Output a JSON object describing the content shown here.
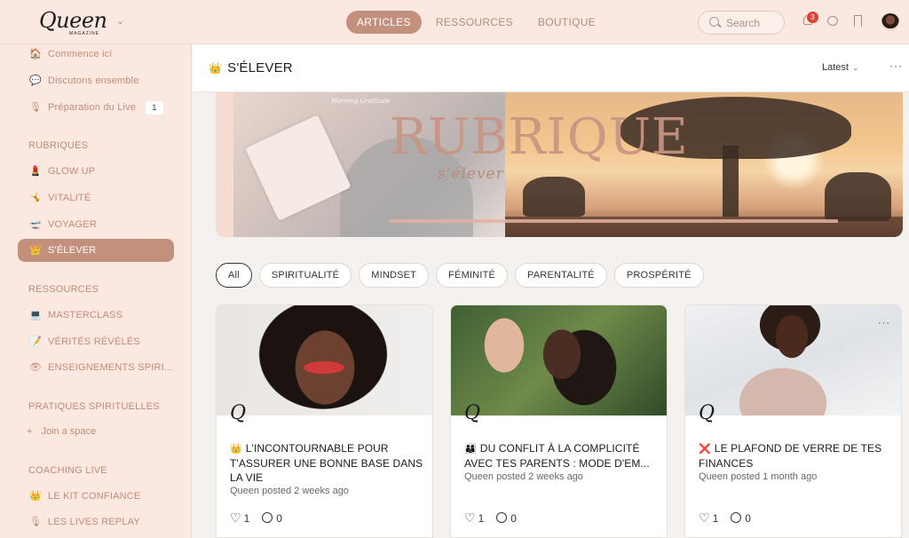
{
  "brand": {
    "logo_text": "Queen",
    "logo_sub": "MAGAZINE"
  },
  "nav": {
    "tabs": [
      "ARTICLES",
      "RESSOURCES",
      "BOUTIQUE"
    ],
    "active": "ARTICLES"
  },
  "search": {
    "placeholder": "Search"
  },
  "notifications": {
    "count": "3"
  },
  "sidebar": {
    "top_items": [
      {
        "emoji": "🏠",
        "label": "Commence ici"
      },
      {
        "emoji": "💬",
        "label": "Discutons ensemble"
      },
      {
        "emoji": "🎙",
        "label": "Préparation du Live",
        "count": "1"
      }
    ],
    "rubriques_heading": "RUBRIQUES",
    "rubriques": [
      {
        "emoji": "💄",
        "label": "GLOW UP"
      },
      {
        "emoji": "🤸",
        "label": "VITALITÉ"
      },
      {
        "emoji": "🛫",
        "label": "VOYAGER"
      },
      {
        "emoji": "👑",
        "label": "S'ÉLEVER"
      }
    ],
    "ressources_heading": "RESSOURCES",
    "ressources": [
      {
        "emoji": "💻",
        "label": "MASTERCLASS"
      },
      {
        "emoji": "📝",
        "label": "VÉRITÉS RÉVÉLÉS"
      },
      {
        "emoji": "👁",
        "label": "ENSEIGNEMENTS SPIRI..."
      }
    ],
    "pratiques_heading": "PRATIQUES SPIRITUELLES",
    "join_label": "Join a space",
    "coaching_heading": "COACHING LIVE",
    "coaching": [
      {
        "emoji": "👑",
        "label": "LE KIT CONFIANCE"
      },
      {
        "emoji": "🎙",
        "label": "LES LIVES REPLAY"
      }
    ]
  },
  "page": {
    "title_emoji": "👑",
    "title": "S'ÉLEVER",
    "sort_label": "Latest",
    "more": "···"
  },
  "banner": {
    "word": "RUBRIQUE",
    "script": "s'élever",
    "caption": "Morning Gratitude"
  },
  "filters": [
    "All",
    "SPIRITUALITÉ",
    "MINDSET",
    "FÉMINITÉ",
    "PARENTALITÉ",
    "PROSPÉRITÉ"
  ],
  "cards": [
    {
      "emoji": "👑",
      "title": "L'INCONTOURNABLE POUR T'ASSURER UNE BONNE BASE DANS LA VIE",
      "meta": "Queen posted 2 weeks ago",
      "likes": "1",
      "comments": "0"
    },
    {
      "emoji": "👨‍👩‍👦",
      "title": "DU CONFLIT À LA COMPLICITÉ AVEC TES PARENTS : MODE D'EM...",
      "meta": "Queen posted 2 weeks ago",
      "likes": "1",
      "comments": "0"
    },
    {
      "emoji": "❌",
      "title": "LE PLAFOND DE VERRE DE TES FINANCES",
      "meta": "Queen posted 1 month ago",
      "likes": "1",
      "comments": "0"
    }
  ],
  "colors": {
    "accent": "#c4907e",
    "sidebar_bg": "#fbe9e1",
    "sidebar_text": "#c38a78",
    "badge": "#e0423a"
  }
}
